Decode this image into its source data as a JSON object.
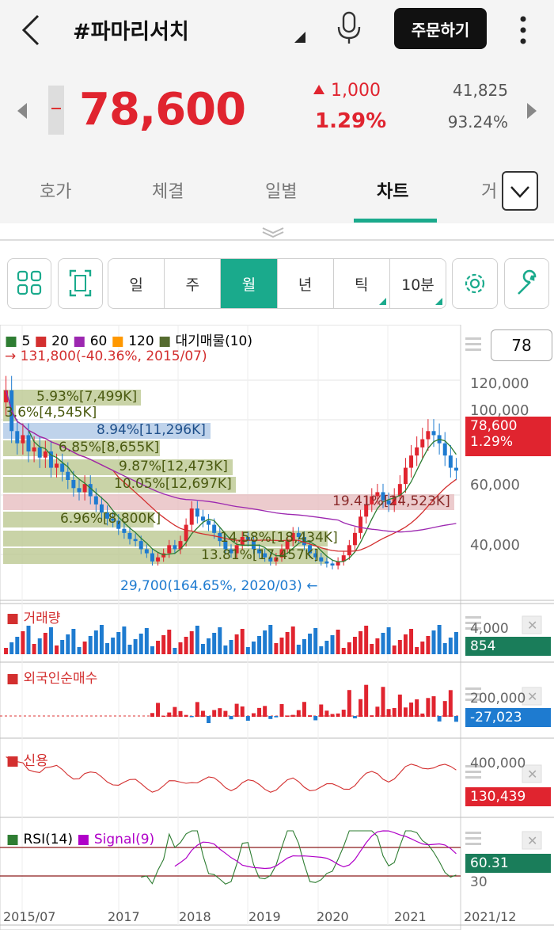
{
  "header": {
    "title": "#파마리서치",
    "order_label": "주문하기",
    "price": "78,600",
    "change": "1,000",
    "change_pct": "1.29%",
    "volume": "41,825",
    "volume_ratio": "93.24%"
  },
  "tabs": [
    "호가",
    "체결",
    "일별",
    "차트",
    "거"
  ],
  "active_tab": "차트",
  "toolbar": {
    "periods": [
      "일",
      "주",
      "월",
      "년",
      "틱",
      "10분"
    ],
    "active_period": "월"
  },
  "chart": {
    "ma_legend": [
      {
        "label": "5",
        "color": "#2e7d32"
      },
      {
        "label": "20",
        "color": "#d32f2f"
      },
      {
        "label": "60",
        "color": "#9c27b0"
      },
      {
        "label": "120",
        "color": "#ff9800"
      },
      {
        "label": "대기매물(10)",
        "color": "#556b2f"
      }
    ],
    "selector_value": "78",
    "high_note": "131,800(-40.36%, 2015/07)",
    "low_note": "29,700(164.65%, 2020/03)",
    "price_axis": [
      "120,000",
      "100,000",
      "60,000",
      "40,000"
    ],
    "current_price_tag": "78,600",
    "current_pct_tag": "1.29%",
    "supply_bands": [
      {
        "label": "5.93%[7,499K]",
        "highlight": "none"
      },
      {
        "label": "3.6%[4,545K]",
        "highlight": "none"
      },
      {
        "label": "8.94%[11,296K]",
        "highlight": "blue"
      },
      {
        "label": "6.85%[8,655K]",
        "highlight": "none"
      },
      {
        "label": "9.87%[12,473K]",
        "highlight": "none"
      },
      {
        "label": "10.05%[12,697K]",
        "highlight": "none"
      },
      {
        "label": "19.41%[24,523K]",
        "highlight": "red"
      },
      {
        "label": "6.96%[8,800K]",
        "highlight": "none"
      },
      {
        "label": "14.58%[18,434K]",
        "highlight": "none"
      },
      {
        "label": "13.81%[17,457K]",
        "highlight": "none"
      }
    ],
    "panels": {
      "volume": {
        "title": "거래량",
        "axis": "4,000",
        "tag": "854"
      },
      "foreign": {
        "title": "외국인순매수",
        "axis": "200,000",
        "tag": "-27,023"
      },
      "credit": {
        "title": "신용",
        "axis": "400,000",
        "tag": "130,439"
      },
      "rsi": {
        "title": "RSI(14)",
        "signal": "Signal(9)",
        "axis": "30",
        "tag": "60.31"
      }
    },
    "x_axis": [
      "2015/07",
      "2017",
      "2018",
      "2019",
      "2020",
      "2021",
      "2021/12"
    ]
  },
  "chart_data": {
    "type": "candlestick",
    "interval": "monthly",
    "x_range": [
      "2015/07",
      "2021/12"
    ],
    "close_series": [
      118000,
      98000,
      92000,
      96000,
      88000,
      90000,
      85000,
      88000,
      80000,
      82000,
      78000,
      74000,
      70000,
      68000,
      72000,
      66000,
      62000,
      58000,
      55000,
      54000,
      50000,
      48000,
      45000,
      44000,
      40000,
      38000,
      34000,
      36000,
      38000,
      42000,
      40000,
      44000,
      52000,
      60000,
      56000,
      54000,
      52000,
      48000,
      44000,
      40000,
      38000,
      42000,
      46000,
      44000,
      40000,
      38000,
      36000,
      34000,
      36000,
      40000,
      44000,
      48000,
      46000,
      42000,
      38000,
      36000,
      34000,
      33000,
      32000,
      34000,
      37000,
      42000,
      48000,
      56000,
      62000,
      66000,
      68000,
      64000,
      62000,
      66000,
      72000,
      80000,
      86000,
      90000,
      94000,
      98000,
      96000,
      92000,
      86000,
      80000,
      78600
    ],
    "last_close": 78600,
    "ylim": [
      25000,
      130000
    ]
  },
  "colors": {
    "up": "#e0242f",
    "down": "#1e7bd0",
    "accent": "#1aaa8c"
  }
}
